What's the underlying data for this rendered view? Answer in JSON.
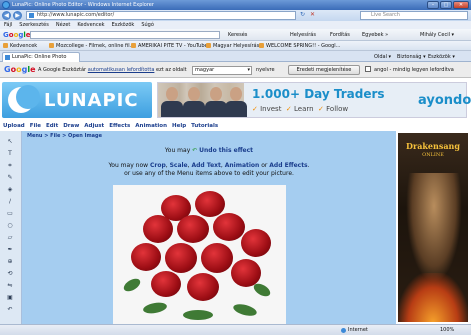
{
  "window": {
    "title": "LunaPic: Online Photo Editor - Windows Internet Explorer",
    "win_buttons": [
      "–",
      "□",
      "✕"
    ]
  },
  "address": {
    "url": "http://www.lunapic.com/editor/",
    "search_placeholder": "Live Search"
  },
  "menubar": {
    "items": [
      "Fájl",
      "Szerkesztés",
      "Nézet",
      "Kedvencek",
      "Eszközök",
      "Súgó"
    ]
  },
  "googlebar": {
    "logo": "Google",
    "items": [
      "Keresés",
      "Helyesírás",
      "Fordítás",
      "Egyebek »",
      "Mihály Cecil ▾"
    ]
  },
  "favorites": {
    "label": "Kedvencek",
    "items": [
      "Mozcollege - Filmek, online fil...",
      "AMERIKAI PITE TV - YouTube",
      "Magyar Helyesírás",
      "WELCOME SPRING!! - Googl..."
    ]
  },
  "tab": {
    "label": "LunaPic: Online Photo Editor"
  },
  "toolbar_right": {
    "items": [
      "Oldal ▾",
      "Biztonság ▾",
      "Eszközök ▾"
    ]
  },
  "translate": {
    "logo": "Google",
    "text_before": "A Google Eszköztár",
    "link": "automatikusan lefordította",
    "text_mid": "ezt az oldalt",
    "source_lang": "magyar",
    "text_after": "nyelvre",
    "show_original": "Eredeti megjelenítése",
    "never_translate": "angol - mindig legyen lefordítva"
  },
  "header": {
    "logo": "LUNAPIC",
    "ad_headline": "1.000+ Day Traders",
    "ad_steps": [
      "Invest",
      "Learn",
      "Follow"
    ],
    "ad_brand": "ayondo"
  },
  "lunamenu": {
    "items": [
      "Upload",
      "File",
      "Edit",
      "Draw",
      "Adjust",
      "Effects",
      "Animation",
      "Help",
      "Tutorials"
    ]
  },
  "main": {
    "breadcrumb": "Menu > File > Open Image",
    "undo_prefix": "You may",
    "undo_link": "Undo this effect",
    "msg_prefix": "You may now",
    "msg_links": [
      "Crop",
      "Scale",
      "Add Text",
      "Animation",
      "Add Effects"
    ],
    "msg_line2": "or use any of the Menu items above to edit your picture."
  },
  "right_ad": {
    "title": "Drakensang",
    "subtitle": "ONLINE"
  },
  "status": {
    "zone": "Internet",
    "zoom": "100%"
  },
  "colors": {
    "main_bg": "#a5cdf0",
    "link": "#1a3d8c",
    "rose": "#c01820",
    "titlebar": "#3b6cb8"
  },
  "icons": [
    "ie-icon",
    "back-icon",
    "forward-icon",
    "refresh-icon",
    "stop-icon",
    "search-icon",
    "undo-icon",
    "internet-zone-icon"
  ]
}
